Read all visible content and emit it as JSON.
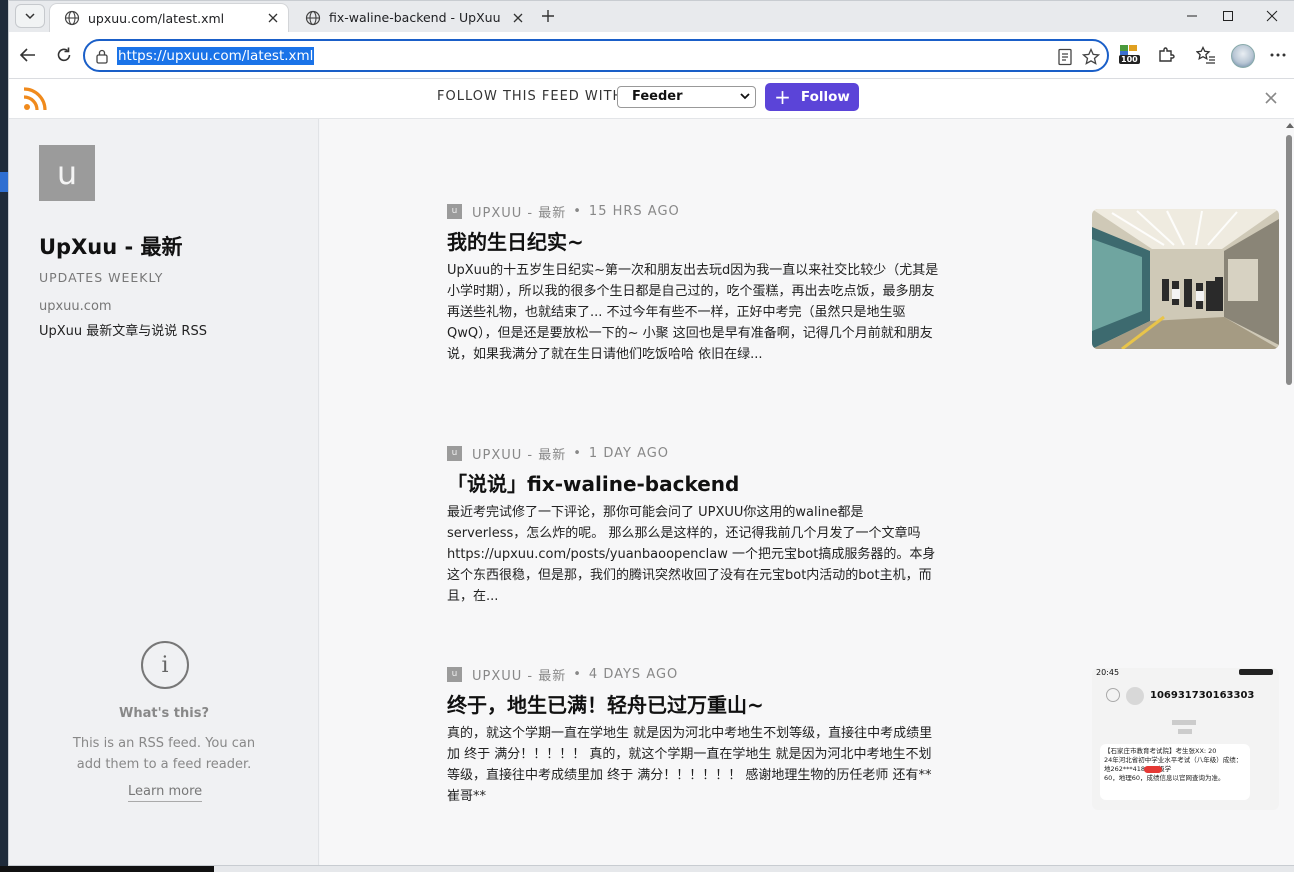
{
  "browser": {
    "tabs": [
      {
        "title": "upxuu.com/latest.xml",
        "active": true
      },
      {
        "title": "fix-waline-backend - UpXuu",
        "active": false
      }
    ],
    "address": "https://upxuu.com/latest.xml",
    "extension_badge": "100"
  },
  "follow_bar": {
    "label": "FOLLOW THIS FEED WITH",
    "reader_selected": "Feeder",
    "follow_button": "Follow"
  },
  "sidebar": {
    "avatar_letter": "u",
    "title": "UpXuu - 最新",
    "updates": "UPDATES WEEKLY",
    "domain": "upxuu.com",
    "description": "UpXuu 最新文章与说说 RSS",
    "whats_this": "What's this?",
    "whats_desc": "This is an RSS feed. You can add them to a feed reader.",
    "learn_more": "Learn more"
  },
  "items": [
    {
      "favicon": "u",
      "source": "UPXUU - 最新",
      "age": "15 HRS AGO",
      "title": "我的生日纪实~",
      "excerpt": "UpXuu的十五岁生日纪实~第一次和朋友出去玩d因为我一直以来社交比较少（尤其是小学时期），所以我的很多个生日都是自己过的，吃个蛋糕，再出去吃点饭，最多朋友再送些礼物，也就结束了... 不过今年有些不一样，正好中考完（虽然只是地生驱QwQ），但是还是要放松一下的~ 小聚 这回也是早有准备啊，记得几个月前就和朋友说，如果我满分了就在生日请他们吃饭哈哈 依旧在绿..."
    },
    {
      "favicon": "u",
      "source": "UPXUU - 最新",
      "age": "1 DAY AGO",
      "title": "「说说」fix-waline-backend",
      "excerpt": "最近考完试修了一下评论，那你可能会问了 UPXUU你这用的waline都是serverless，怎么炸的呢。 那么那么是这样的，还记得我前几个月发了一个文章吗 https://upxuu.com/posts/yuanbaoopenclaw 一个把元宝bot搞成服务器的。本身这个东西很稳，但是那，我们的腾讯突然收回了没有在元宝bot内活动的bot主机，而且，在..."
    },
    {
      "favicon": "u",
      "source": "UPXUU - 最新",
      "age": "4 DAYS AGO",
      "title": "终于，地生已满！轻舟已过万重山~",
      "excerpt": "真的，就这个学期一直在学地生 就是因为河北中考地生不划等级，直接往中考成绩里加 终于 满分！！！！！ 真的，就这个学期一直在学地生 就是因为河北中考地生不划等级，直接往中考成绩里加 终于 满分！！！！！！ 感谢地理生物的历任老师 还有** 崔哥**"
    }
  ],
  "thumb3": {
    "time": "20:45",
    "number": "106931730163303",
    "line1": "【石家庄市教育考试院】考生张XX: 20",
    "line2": "24年河北省初中学业水平考试（八年级）成绩：地262***418，二级学",
    "line3": "60，地理60，成绩信息以官网查询为准。"
  }
}
